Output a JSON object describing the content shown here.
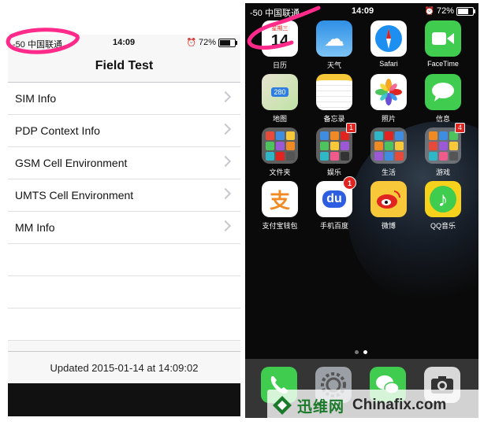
{
  "left_phone": {
    "status": {
      "carrier": "-50 中国联通",
      "time": "14:09",
      "battery": "72%"
    },
    "title": "Field Test",
    "rows": [
      {
        "label": "SIM Info"
      },
      {
        "label": "PDP Context Info"
      },
      {
        "label": "GSM Cell Environment"
      },
      {
        "label": "UMTS Cell Environment"
      },
      {
        "label": "MM Info"
      }
    ],
    "updated": "Updated 2015-01-14 at 14:09:02"
  },
  "right_phone": {
    "status": {
      "carrier": "-50 中国联通",
      "time": "14:09",
      "battery": "72%"
    },
    "apps": [
      {
        "label": "日历",
        "icon": "calendar-icon",
        "glyph": "14"
      },
      {
        "label": "天气",
        "icon": "weather-icon",
        "glyph": "☁"
      },
      {
        "label": "Safari",
        "icon": "safari-icon",
        "glyph": "🧭"
      },
      {
        "label": "FaceTime",
        "icon": "facetime-icon",
        "glyph": "▶"
      },
      {
        "label": "地图",
        "icon": "maps-icon",
        "glyph": "280"
      },
      {
        "label": "备忘录",
        "icon": "notes-icon",
        "glyph": ""
      },
      {
        "label": "照片",
        "icon": "photos-icon",
        "glyph": "✿"
      },
      {
        "label": "信息",
        "icon": "messages-icon",
        "glyph": "💬"
      },
      {
        "label": "文件夹",
        "icon": "folder-icon",
        "glyph": ""
      },
      {
        "label": "娱乐",
        "icon": "folder-icon",
        "glyph": "",
        "badge": "1"
      },
      {
        "label": "生活",
        "icon": "folder-icon",
        "glyph": ""
      },
      {
        "label": "游戏",
        "icon": "folder-icon",
        "glyph": "",
        "badge": "4"
      },
      {
        "label": "支付宝钱包",
        "icon": "alipay-icon",
        "glyph": "支"
      },
      {
        "label": "手机百度",
        "icon": "baidu-icon",
        "glyph": "du",
        "badge": "1"
      },
      {
        "label": "微博",
        "icon": "weibo-icon",
        "glyph": "◉"
      },
      {
        "label": "QQ音乐",
        "icon": "qqmusic-icon",
        "glyph": "♪"
      }
    ],
    "dock": [
      {
        "icon": "phone-icon"
      },
      {
        "icon": "settings-icon"
      },
      {
        "icon": "wechat-icon"
      },
      {
        "icon": "camera-icon"
      }
    ]
  },
  "watermark": {
    "cn": "迅维网",
    "en": "Chinafix.com"
  },
  "colors": {
    "ios_separator": "#c8c7cc",
    "chevron": "#c7c7cc",
    "badge_red": "#e0241f",
    "annotation_pink": "#ff2a8a",
    "watermark_green": "#1a7a2a"
  }
}
